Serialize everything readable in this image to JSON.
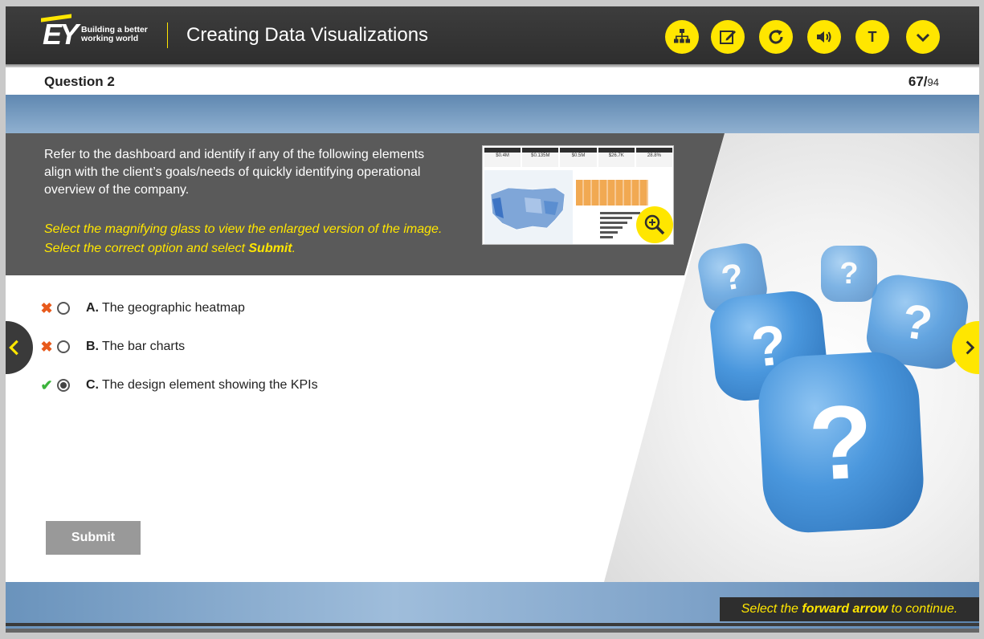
{
  "brand": {
    "logo": "EY",
    "tagline_line1": "Building a better",
    "tagline_line2": "working world",
    "accent_color": "#ffe600"
  },
  "header": {
    "course_title": "Creating Data Visualizations",
    "buttons": [
      {
        "name": "menu",
        "icon": "sitemap-icon"
      },
      {
        "name": "notes",
        "icon": "edit-icon"
      },
      {
        "name": "replay",
        "icon": "replay-icon"
      },
      {
        "name": "audio",
        "icon": "speaker-icon"
      },
      {
        "name": "transcript",
        "icon": "T",
        "label": "T"
      },
      {
        "name": "more",
        "icon": "chevron-down-icon"
      }
    ]
  },
  "question": {
    "label": "Question 2",
    "current": "67",
    "separator": "/",
    "total": "94"
  },
  "instructions": {
    "text": "Refer to the dashboard and identify if any of the following elements align with the client’s goals/needs of quickly identifying operational overview of the company.",
    "hint_line1": "Select the magnifying glass to view the enlarged version of the image.",
    "hint_line2_prefix": "Select the correct option and select ",
    "hint_line2_bold": "Submit",
    "hint_line2_suffix": "."
  },
  "thumbnail": {
    "kpis": [
      "$0.4M",
      "$0.135M",
      "$0.5M",
      "$26.7K",
      "28.8%"
    ]
  },
  "options": [
    {
      "letter": "A.",
      "text": "The geographic heatmap",
      "mark": "✖",
      "selected": false
    },
    {
      "letter": "B.",
      "text": "The bar charts",
      "mark": "✖",
      "selected": false
    },
    {
      "letter": "C.",
      "text": "The design element showing the KPIs",
      "mark": "✔",
      "selected": true
    }
  ],
  "submit_label": "Submit",
  "footer": {
    "prefix": "Select the ",
    "bold": "forward arrow",
    "suffix": " to continue."
  }
}
